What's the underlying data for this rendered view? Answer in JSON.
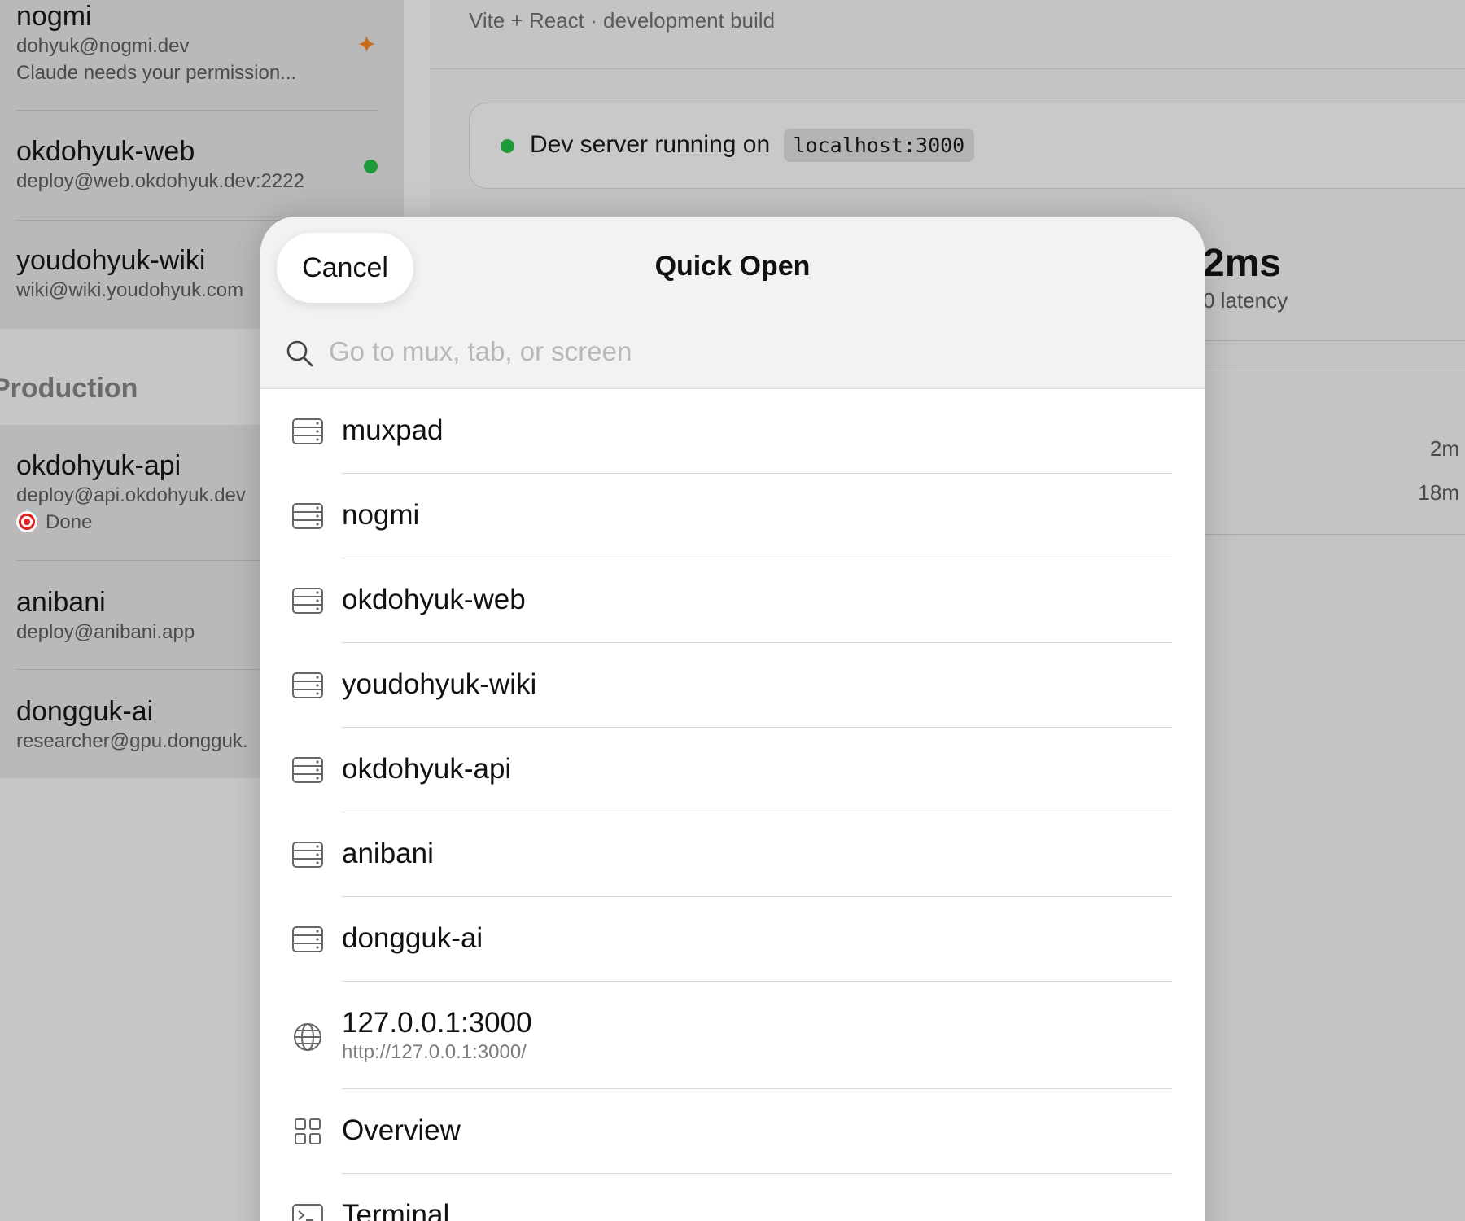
{
  "sidebar": {
    "hosts": [
      {
        "name": "nogmi",
        "address": "dohyuk@nogmi.dev",
        "status": "Claude needs your permission..."
      },
      {
        "name": "okdohyuk-web",
        "address": "deploy@web.okdohyuk.dev:2222"
      },
      {
        "name": "youdohyuk-wiki",
        "address": "wiki@wiki.youdohyuk.com"
      }
    ],
    "section_label": "Production",
    "production_hosts": [
      {
        "name": "okdohyuk-api",
        "address": "deploy@api.okdohyuk.dev",
        "status": "Done"
      },
      {
        "name": "anibani",
        "address": "deploy@anibani.app"
      },
      {
        "name": "dongguk-ai",
        "address": "researcher@gpu.dongguk."
      }
    ]
  },
  "main": {
    "header": "Vite + React · development build",
    "server_status": "Dev server running on",
    "server_address": "localhost:3000",
    "stat_value": "2ms",
    "stat_label": "0 latency",
    "times": [
      "2m",
      "18m"
    ]
  },
  "quick_open": {
    "cancel_label": "Cancel",
    "title": "Quick Open",
    "search_placeholder": "Go to mux, tab, or screen",
    "items": [
      {
        "label": "muxpad",
        "icon": "server-icon"
      },
      {
        "label": "nogmi",
        "icon": "server-icon"
      },
      {
        "label": "okdohyuk-web",
        "icon": "server-icon"
      },
      {
        "label": "youdohyuk-wiki",
        "icon": "server-icon"
      },
      {
        "label": "okdohyuk-api",
        "icon": "server-icon"
      },
      {
        "label": "anibani",
        "icon": "server-icon"
      },
      {
        "label": "dongguk-ai",
        "icon": "server-icon"
      },
      {
        "label": "127.0.0.1:3000",
        "sublabel": "http://127.0.0.1:3000/",
        "icon": "globe-icon"
      },
      {
        "label": "Overview",
        "icon": "grid-icon"
      },
      {
        "label": "Terminal",
        "icon": "terminal-icon"
      }
    ]
  },
  "colors": {
    "accent_green": "#1f9a3a",
    "sparkle_orange": "#c76a1a"
  }
}
